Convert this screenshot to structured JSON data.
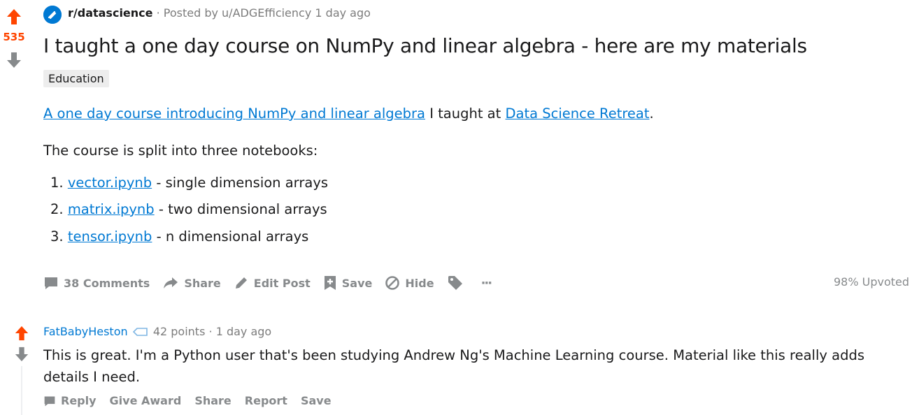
{
  "post": {
    "score": "535",
    "subreddit": "r/datascience",
    "posted_by": "· Posted by u/ADGEfficiency 1 day ago",
    "title": "I taught a one day course on NumPy and linear algebra - here are my materials",
    "flair": "Education",
    "para1_link1": "A one day course introducing NumPy and linear algebra",
    "para1_text": " I taught at ",
    "para1_link2": "Data Science Retreat",
    "para1_end": ".",
    "para2": "The course is split into three notebooks:",
    "list": [
      {
        "num": "1.",
        "link": "vector.ipynb",
        "text": " - single dimension arrays"
      },
      {
        "num": "2.",
        "link": "matrix.ipynb",
        "text": " - two dimensional arrays"
      },
      {
        "num": "3.",
        "link": "tensor.ipynb",
        "text": " - n dimensional arrays"
      }
    ],
    "actions": {
      "comments": "38 Comments",
      "share": "Share",
      "edit": "Edit Post",
      "save": "Save",
      "hide": "Hide",
      "more": "···"
    },
    "upvoted": "98% Upvoted"
  },
  "comment": {
    "author": "FatBabyHeston",
    "points": "42 points",
    "time": "· 1 day ago",
    "body": "This is great. I'm a Python user that's been studying Andrew Ng's Machine Learning course. Material like this really adds details I need.",
    "actions": {
      "reply": "Reply",
      "give_award": "Give Award",
      "share": "Share",
      "report": "Report",
      "save": "Save"
    }
  },
  "colors": {
    "upvote": "#ff4500",
    "link": "#0079d3",
    "muted": "#878a8c",
    "flair_bg": "#ededed"
  }
}
